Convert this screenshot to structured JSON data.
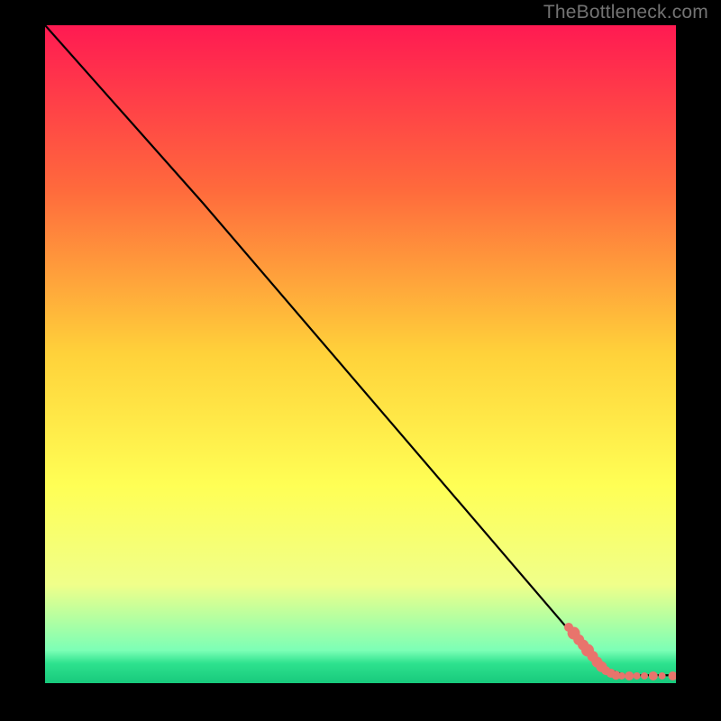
{
  "watermark": "TheBottleneck.com",
  "chart_data": {
    "type": "line",
    "title": "",
    "xlabel": "",
    "ylabel": "",
    "xlim": [
      0,
      100
    ],
    "ylim": [
      0,
      100
    ],
    "background_gradient": {
      "stops": [
        {
          "y": 0,
          "color": "#ff1a52"
        },
        {
          "y": 25,
          "color": "#ff6a3c"
        },
        {
          "y": 50,
          "color": "#ffd23a"
        },
        {
          "y": 70,
          "color": "#ffff55"
        },
        {
          "y": 85,
          "color": "#f0ff8a"
        },
        {
          "y": 95,
          "color": "#7cffb6"
        },
        {
          "y": 97,
          "color": "#2ee28e"
        },
        {
          "y": 100,
          "color": "#17c97c"
        }
      ]
    },
    "curve": {
      "name": "bottleneck-curve",
      "points": [
        {
          "x": 0,
          "y": 100
        },
        {
          "x": 25,
          "y": 73
        },
        {
          "x": 88,
          "y": 2.5
        },
        {
          "x": 92,
          "y": 1.2
        },
        {
          "x": 100,
          "y": 1.2
        }
      ]
    },
    "markers": {
      "name": "sample-points",
      "color": "#e8746c",
      "points": [
        {
          "x": 83,
          "y": 8.5,
          "r": 5
        },
        {
          "x": 83.8,
          "y": 7.6,
          "r": 7
        },
        {
          "x": 84.6,
          "y": 6.6,
          "r": 6
        },
        {
          "x": 85.3,
          "y": 5.8,
          "r": 6
        },
        {
          "x": 86.0,
          "y": 5.0,
          "r": 7
        },
        {
          "x": 86.8,
          "y": 4.1,
          "r": 6
        },
        {
          "x": 87.5,
          "y": 3.2,
          "r": 6
        },
        {
          "x": 88.2,
          "y": 2.5,
          "r": 6
        },
        {
          "x": 88.9,
          "y": 1.9,
          "r": 5
        },
        {
          "x": 89.7,
          "y": 1.5,
          "r": 5
        },
        {
          "x": 90.5,
          "y": 1.2,
          "r": 5
        },
        {
          "x": 91.4,
          "y": 1.1,
          "r": 4
        },
        {
          "x": 92.6,
          "y": 1.1,
          "r": 5
        },
        {
          "x": 93.8,
          "y": 1.1,
          "r": 4
        },
        {
          "x": 95.0,
          "y": 1.1,
          "r": 4
        },
        {
          "x": 96.4,
          "y": 1.1,
          "r": 5
        },
        {
          "x": 97.8,
          "y": 1.1,
          "r": 4
        },
        {
          "x": 99.5,
          "y": 1.1,
          "r": 5
        }
      ]
    }
  }
}
